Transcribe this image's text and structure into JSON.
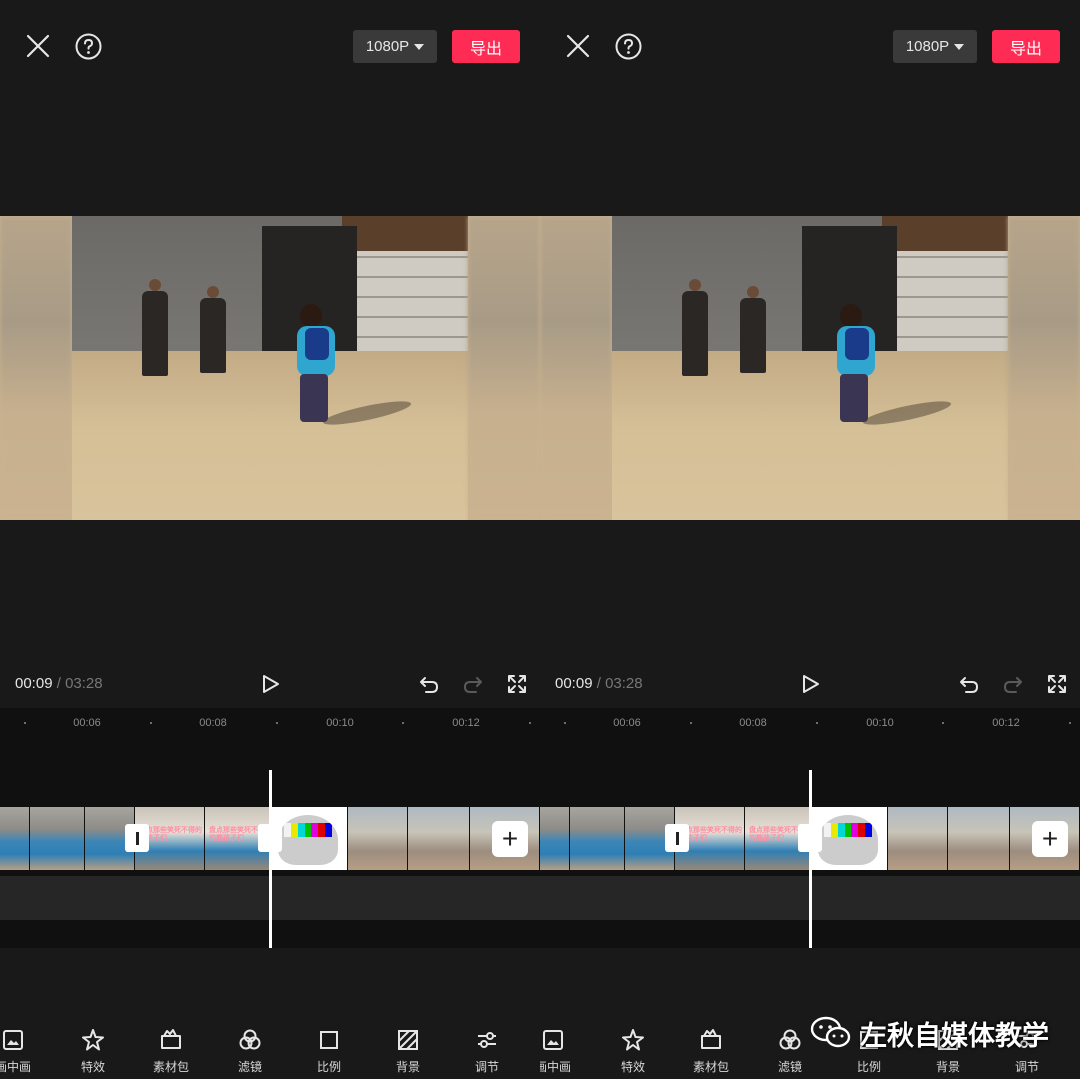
{
  "top_bar": {
    "resolution": "1080P",
    "export_label": "导出"
  },
  "player": {
    "current_time": "00:09",
    "separator": " / ",
    "total_time": "03:28"
  },
  "timeline": {
    "ticks": [
      "00:06",
      "00:08",
      "00:10",
      "00:12"
    ],
    "overlay_text_1": "盘点那些笑死不得的熊孩子们",
    "overlay_text_2": "盘点那些笑死不得的熊孩子们"
  },
  "toolbar": {
    "items": [
      "画中画",
      "特效",
      "素材包",
      "滤镜",
      "比例",
      "背景",
      "调节"
    ],
    "icons": [
      "picture-in-picture-icon",
      "sparkle-icon",
      "folder-icon",
      "filter-icon",
      "ratio-icon",
      "background-icon",
      "adjust-icon"
    ]
  },
  "watermark": {
    "text": "左秋自媒体教学"
  },
  "colors": {
    "background": "#191919",
    "export": "#fe2c55",
    "timeline_bg": "#101010"
  }
}
